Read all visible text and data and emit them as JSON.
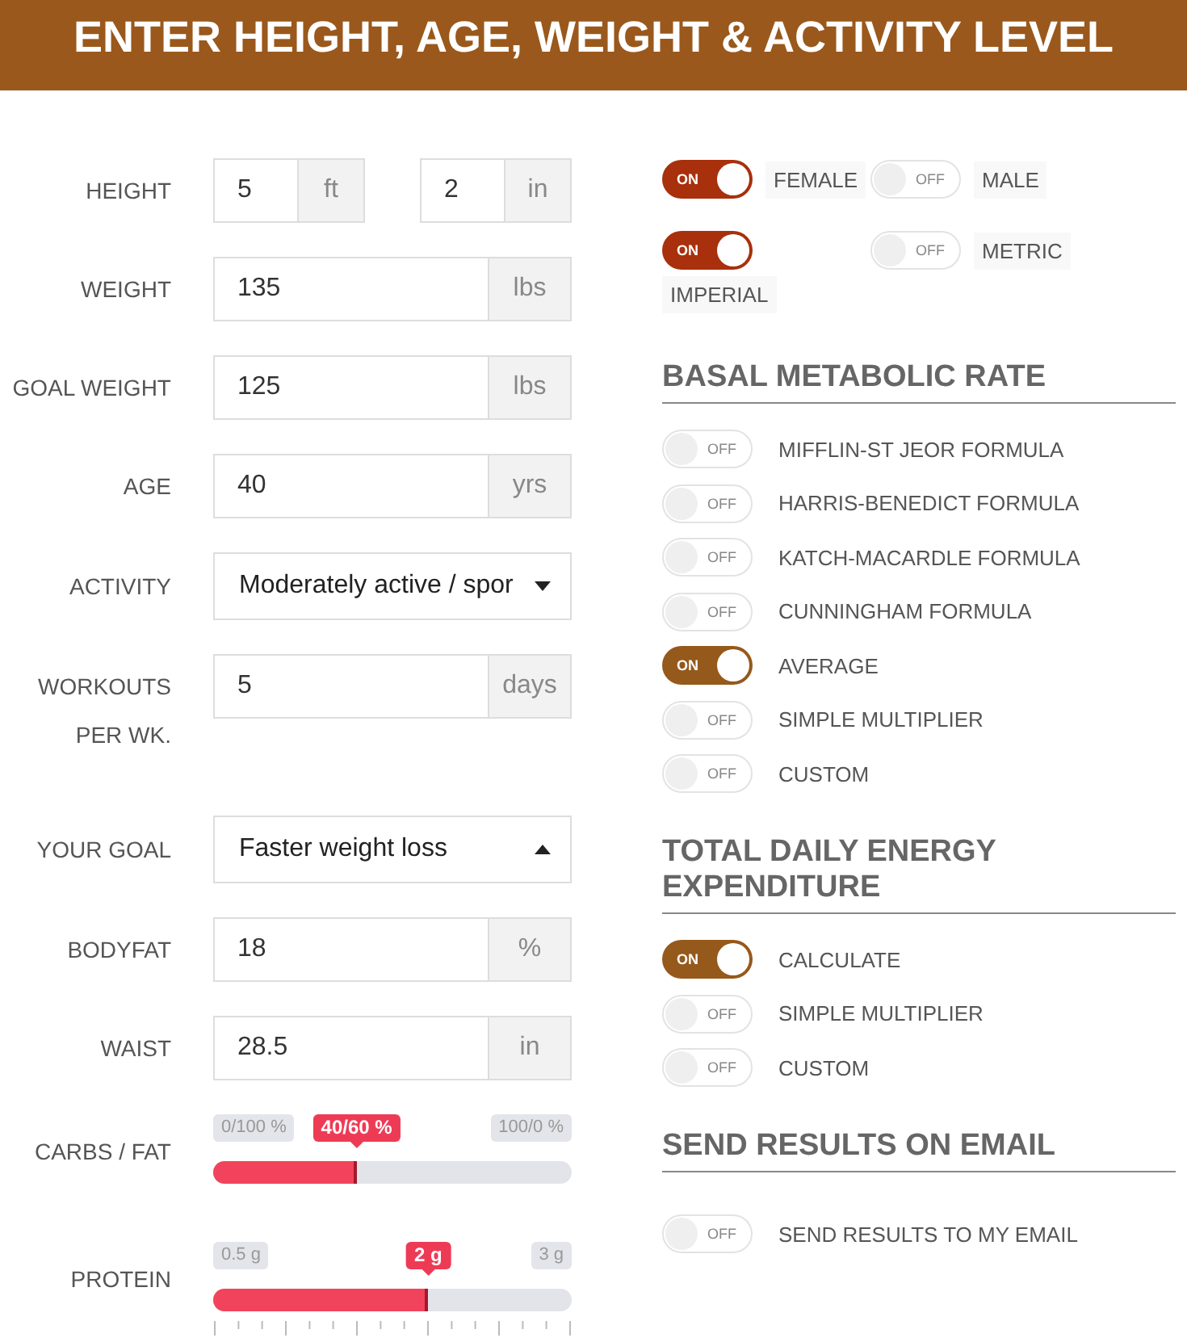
{
  "header": {
    "title": "ENTER HEIGHT, AGE, WEIGHT & ACTIVITY LEVEL"
  },
  "fields": [
    {
      "kind": "dual",
      "label": "HEIGHT",
      "parts": [
        {
          "value": "5",
          "unit": "ft"
        },
        {
          "value": "2",
          "unit": "in"
        }
      ]
    },
    {
      "kind": "input",
      "label": "WEIGHT",
      "value": "135",
      "unit": "lbs"
    },
    {
      "kind": "input",
      "label": "GOAL WEIGHT",
      "value": "125",
      "unit": "lbs"
    },
    {
      "kind": "input",
      "label": "AGE",
      "value": "40",
      "unit": "yrs"
    },
    {
      "kind": "select",
      "label": "ACTIVITY",
      "value": "Moderately active / spor",
      "expanded": false
    },
    {
      "kind": "input",
      "label": "WORKOUTS PER WK.",
      "value": "5",
      "unit": "days"
    },
    {
      "kind": "select",
      "label": "YOUR GOAL",
      "value": "Faster weight loss",
      "expanded": true
    },
    {
      "kind": "input",
      "label": "BODYFAT",
      "value": "18",
      "unit": "%"
    },
    {
      "kind": "input",
      "label": "WAIST",
      "value": "28.5",
      "unit": "in"
    },
    {
      "kind": "slider",
      "label": "CARBS / FAT",
      "min": "0/100 %",
      "max": "100/0 %",
      "reading": "40/60 %",
      "level": 0.4,
      "ticks": false
    },
    {
      "kind": "slider",
      "label": "PROTEIN",
      "min": "0.5 g",
      "max": "3 g",
      "reading": "2 g",
      "level": 0.6,
      "ticks": true
    }
  ],
  "options": [
    {
      "label": "FEMALE",
      "on": true,
      "switch_text": "ON"
    },
    {
      "label": "MALE",
      "on": false,
      "switch_text": "OFF"
    },
    {
      "label": "IMPERIAL",
      "on": true,
      "switch_text": "ON"
    },
    {
      "label": "METRIC",
      "on": false,
      "switch_text": "OFF"
    }
  ],
  "sections": [
    {
      "title": "BASAL METABOLIC RATE",
      "toggles": [
        {
          "label": "MIFFLIN-ST JEOR FORMULA",
          "on": false,
          "switch_text": "OFF"
        },
        {
          "label": "HARRIS-BENEDICT FORMULA",
          "on": false,
          "switch_text": "OFF"
        },
        {
          "label": "KATCH-MACARDLE FORMULA",
          "on": false,
          "switch_text": "OFF"
        },
        {
          "label": "CUNNINGHAM FORMULA",
          "on": false,
          "switch_text": "OFF"
        },
        {
          "label": "AVERAGE",
          "on": true,
          "switch_text": "ON"
        },
        {
          "label": "SIMPLE MULTIPLIER",
          "on": false,
          "switch_text": "OFF"
        },
        {
          "label": "CUSTOM",
          "on": false,
          "switch_text": "OFF"
        }
      ]
    },
    {
      "title": "TOTAL DAILY ENERGY EXPENDITURE",
      "toggles": [
        {
          "label": "CALCULATE",
          "on": true,
          "switch_text": "ON"
        },
        {
          "label": "SIMPLE MULTIPLIER",
          "on": false,
          "switch_text": "OFF"
        },
        {
          "label": "CUSTOM",
          "on": false,
          "switch_text": "OFF"
        }
      ]
    },
    {
      "title": "SEND RESULTS ON EMAIL",
      "toggles": [
        {
          "label": "SEND RESULTS TO MY EMAIL",
          "on": false,
          "switch_text": "OFF"
        }
      ]
    }
  ]
}
